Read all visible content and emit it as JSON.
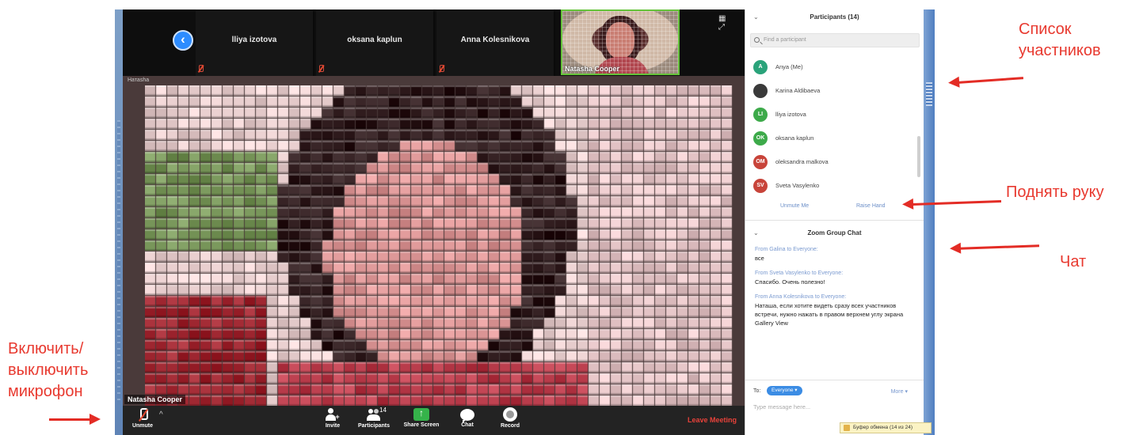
{
  "thumbnails": [
    {
      "name": "lliya izotova"
    },
    {
      "name": "oksana kaplun"
    },
    {
      "name": "Anna Kolesnikova"
    }
  ],
  "active_thumbnail": {
    "name": "Natasha Cooper"
  },
  "view_icons": "▦ ⤢",
  "back_icon": "‹",
  "speaker_tag": "Натаsha",
  "main_video": {
    "name": "Natasha Cooper"
  },
  "toolbar": {
    "unmute": "Unmute",
    "caret": "^",
    "invite": "Invite",
    "participants": "Participants",
    "participants_count": "14",
    "share": "Share Screen",
    "chat": "Chat",
    "record": "Record",
    "leave": "Leave Meeting"
  },
  "participants_panel": {
    "title": "Participants (14)",
    "chevron": "⌄",
    "search_placeholder": "Find a participant",
    "items": [
      {
        "initials": "A",
        "name": "Anya (Me)",
        "color": "#2aa37a"
      },
      {
        "initials": "",
        "name": "Karina Aldibaeva",
        "color": "#3a3a3a"
      },
      {
        "initials": "LI",
        "name": "lliya izotova",
        "color": "#3daa4a"
      },
      {
        "initials": "OK",
        "name": "oksana kaplun",
        "color": "#3daa4a"
      },
      {
        "initials": "OM",
        "name": "oleksandra malkova",
        "color": "#c8443a"
      },
      {
        "initials": "SV",
        "name": "Sveta Vasylenko",
        "color": "#c8443a"
      }
    ],
    "invite_label": "Unmute Me",
    "raise_hand": "Raise Hand"
  },
  "chat_panel": {
    "title": "Zoom Group Chat",
    "chevron": "⌄",
    "messages": [
      {
        "from": "From Galina to Everyone:",
        "text": "все"
      },
      {
        "from": "From Sveta Vasylenko to Everyone:",
        "text": "Спасибо. Очень полезно!"
      },
      {
        "from": "From Anna Kolesnikova to Everyone:",
        "text": "Наташа, если хотите видеть сразу всех участников встречи, нужно нажать в правом верхнем углу экрана Gallery View"
      }
    ],
    "to_label": "To:",
    "to_value": "Everyone ▾",
    "more": "More ▾",
    "placeholder": "Type message here..."
  },
  "clipboard": "Буфер обмена (14 из 24)",
  "annotations": {
    "participants_list": "Список участников",
    "raise_hand": "Поднять руку",
    "chat": "Чат",
    "mic": "Включить/ выключить микрофон"
  },
  "colors": {
    "accent_blue": "#2d8cff",
    "leave_red": "#e8423a",
    "annotation_red": "#e32c25",
    "active_green": "#65c23a"
  }
}
